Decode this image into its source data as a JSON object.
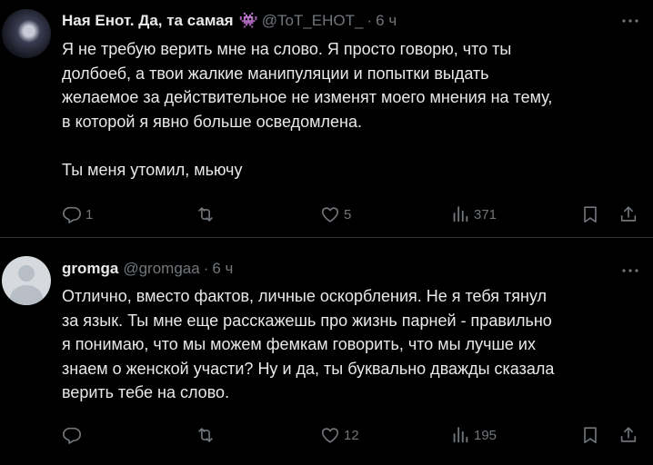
{
  "tweets": [
    {
      "author_name": "Ная Енот. Да, та самая",
      "badge_emoji": "👾",
      "handle": "@ToT_EHOT_",
      "time": "6 ч",
      "text": "Я не требую верить мне на слово. Я просто говорю, что ты\nдолбоеб, а твои жалкие манипуляции и попытки выдать\nжелаемое за действительное не изменят моего мнения на тему,\nв которой я явно больше осведомлена.\n\nТы меня утомил, мьючу",
      "replies": "1",
      "retweets": "",
      "likes": "5",
      "views": "371"
    },
    {
      "author_name": "gromga",
      "handle": "@gromgaa",
      "time": "6 ч",
      "text": "Отлично, вместо фактов, личные оскорбления. Не я тебя тянул\nза язык. Ты мне еще расскажешь про жизнь парней - правильно\nя понимаю, что мы можем фемкам говорить, что мы лучше их\nзнаем о женской участи? Ну и да, ты буквально дважды сказала\nверить тебе на слово.",
      "replies": "",
      "retweets": "",
      "likes": "12",
      "views": "195"
    }
  ],
  "separator": "·",
  "colors": {
    "background": "#000000",
    "text": "#e7e9ea",
    "muted": "#71767b",
    "divider": "#2f3336"
  },
  "icons": [
    "avatar",
    "more-icon",
    "reply-icon",
    "retweet-icon",
    "like-icon",
    "views-icon",
    "bookmark-icon",
    "share-icon"
  ]
}
